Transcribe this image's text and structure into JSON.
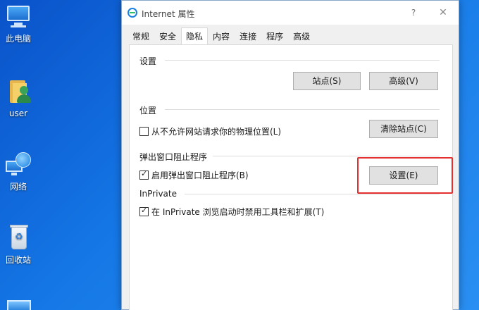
{
  "desktop": {
    "icons": [
      {
        "label": "此电脑",
        "icon": "computer-icon"
      },
      {
        "label": "user",
        "icon": "user-folder-icon"
      },
      {
        "label": "网络",
        "icon": "network-icon"
      },
      {
        "label": "回收站",
        "icon": "recycle-bin-icon"
      }
    ]
  },
  "dialog": {
    "title": "Internet 属性",
    "help": "?",
    "close": "✕",
    "tabs": [
      "常规",
      "安全",
      "隐私",
      "内容",
      "连接",
      "程序",
      "高级"
    ],
    "active_tab": "隐私",
    "settings": {
      "title": "设置",
      "sites_button": "站点(S)",
      "advanced_button": "高级(V)"
    },
    "location": {
      "title": "位置",
      "checkbox_label": "从不允许网站请求你的物理位置(L)",
      "checked": false,
      "clear_button": "清除站点(C)"
    },
    "popup": {
      "title": "弹出窗口阻止程序",
      "checkbox_label": "启用弹出窗口阻止程序(B)",
      "checked": true,
      "settings_button": "设置(E)"
    },
    "inprivate": {
      "title": "InPrivate",
      "checkbox_label": "在 InPrivate 浏览启动时禁用工具栏和扩展(T)",
      "checked": true
    },
    "highlight_color": "#e53030"
  }
}
